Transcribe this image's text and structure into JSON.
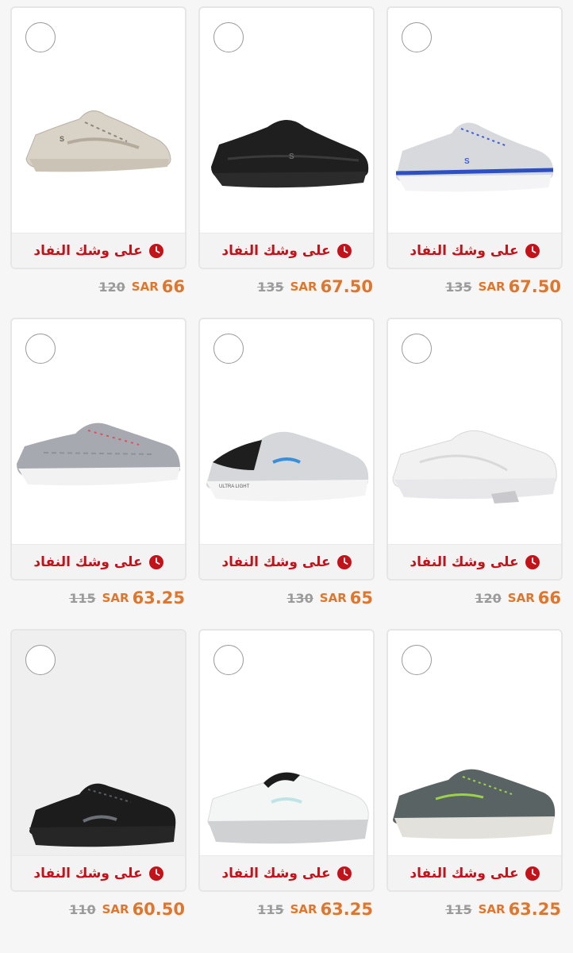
{
  "badge_label": "على وشك النفاد",
  "currency": "SAR",
  "colors": {
    "badge_text": "#c3121a",
    "price": "#e0762b",
    "old_price": "#9b9b9b"
  },
  "products": [
    {
      "position": "row1-left",
      "old_price": "120",
      "new_price": "66",
      "shoe_icon": "beige-knit-sneaker-icon"
    },
    {
      "position": "row1-middle",
      "old_price": "135",
      "new_price": "67.50",
      "shoe_icon": "black-slip-on-sneaker-icon"
    },
    {
      "position": "row1-right",
      "old_price": "135",
      "new_price": "67.50",
      "shoe_icon": "grey-blue-sneaker-icon"
    },
    {
      "position": "row2-left",
      "old_price": "115",
      "new_price": "63.25",
      "shoe_icon": "grey-lace-sneaker-icon"
    },
    {
      "position": "row2-middle",
      "old_price": "130",
      "new_price": "65",
      "shoe_icon": "grey-black-ultra-light-sneaker-icon"
    },
    {
      "position": "row2-right",
      "old_price": "120",
      "new_price": "66",
      "shoe_icon": "white-leather-sneaker-icon"
    },
    {
      "position": "row3-left",
      "old_price": "110",
      "new_price": "60.50",
      "shoe_icon": "black-knit-sneaker-icon"
    },
    {
      "position": "row3-middle",
      "old_price": "115",
      "new_price": "63.25",
      "shoe_icon": "white-black-sneaker-icon"
    },
    {
      "position": "row3-right",
      "old_price": "115",
      "new_price": "63.25",
      "shoe_icon": "olive-green-sneaker-icon"
    }
  ]
}
